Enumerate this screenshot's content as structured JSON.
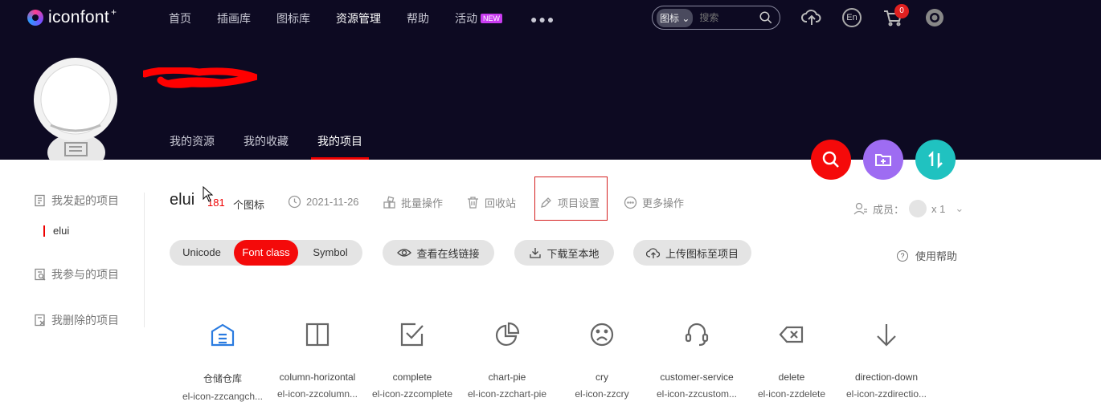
{
  "header": {
    "logo_text": "iconfont",
    "logo_plus": "+",
    "nav": [
      {
        "label": "首页"
      },
      {
        "label": "插画库"
      },
      {
        "label": "图标库"
      },
      {
        "label": "资源管理",
        "active": true
      },
      {
        "label": "帮助"
      },
      {
        "label": "活动",
        "badge": "NEW"
      }
    ],
    "search": {
      "select": "图标",
      "placeholder": "搜索"
    },
    "lang_label": "En",
    "cart_count": "0"
  },
  "profile": {
    "tabs": [
      "我的资源",
      "我的收藏",
      "我的项目"
    ],
    "active_tab": "我的项目",
    "fab_colors": [
      "#f50a0a",
      "#9e6cf2",
      "#20c2c0"
    ]
  },
  "sidebar": {
    "items": [
      "我发起的项目",
      "我参与的项目",
      "我删除的项目"
    ],
    "sub_item": "elui"
  },
  "project": {
    "name": "elui",
    "count": "181",
    "count_label": "个图标",
    "date": "2021-11-26",
    "actions": [
      "批量操作",
      "回收站",
      "项目设置",
      "更多操作"
    ],
    "members_label": "成员：",
    "members_count": "x 1"
  },
  "toolbar": {
    "modes": [
      "Unicode",
      "Font class",
      "Symbol"
    ],
    "active_mode": "Font class",
    "view_online": "查看在线链接",
    "download": "下载至本地",
    "upload": "上传图标至项目",
    "help": "使用帮助"
  },
  "icons": [
    {
      "name": "仓储仓库",
      "class": "el-icon-zzcangch...",
      "icon": "warehouse-icon",
      "color": "#2a7be0"
    },
    {
      "name": "column-horizontal",
      "class": "el-icon-zzcolumn...",
      "icon": "column-horizontal-icon",
      "color": "#666666"
    },
    {
      "name": "complete",
      "class": "el-icon-zzcomplete",
      "icon": "checkbox-complete-icon",
      "color": "#666666"
    },
    {
      "name": "chart-pie",
      "class": "el-icon-zzchart-pie",
      "icon": "chart-pie-icon",
      "color": "#666666"
    },
    {
      "name": "cry",
      "class": "el-icon-zzcry",
      "icon": "cry-face-icon",
      "color": "#666666"
    },
    {
      "name": "customer-service",
      "class": "el-icon-zzcustom...",
      "icon": "headset-icon",
      "color": "#666666"
    },
    {
      "name": "delete",
      "class": "el-icon-zzdelete",
      "icon": "backspace-delete-icon",
      "color": "#666666"
    },
    {
      "name": "direction-down",
      "class": "el-icon-zzdirectio...",
      "icon": "arrow-down-icon",
      "color": "#666666"
    }
  ]
}
